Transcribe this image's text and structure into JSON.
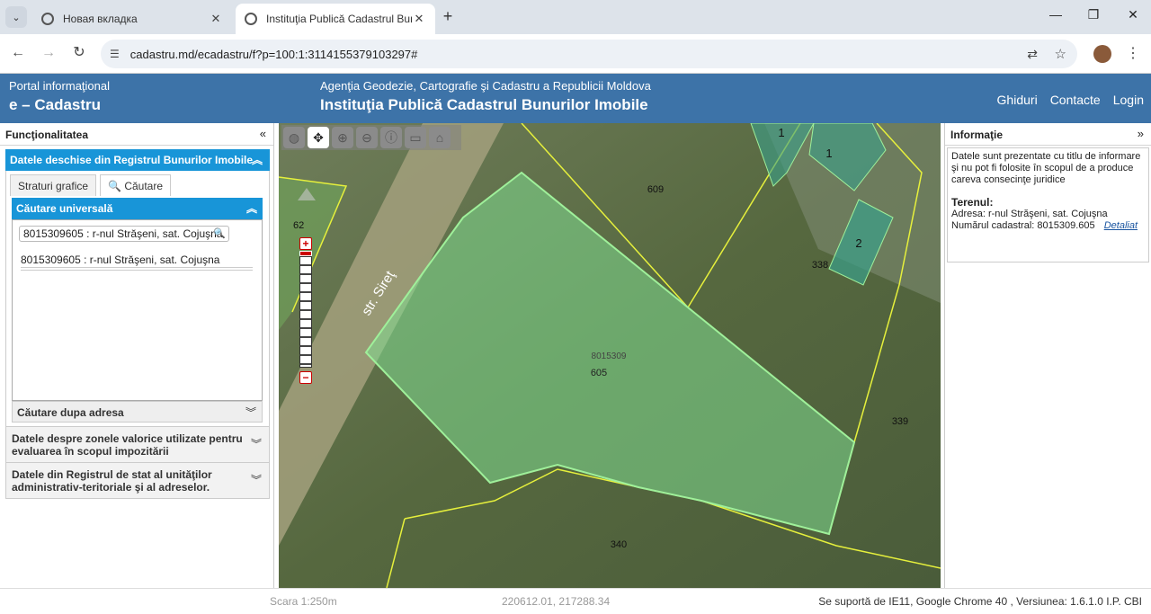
{
  "browser": {
    "tabs": [
      {
        "title": "Новая вкладка"
      },
      {
        "title": "Instituţia Publică Cadastrul Bunurilor Imobile"
      }
    ],
    "url": "cadastru.md/ecadastru/f?p=100:1:3114155379103297#",
    "controls": {
      "minimize": "—",
      "restore": "❐",
      "close": "✕",
      "new_tab": "+",
      "back": "←",
      "forward": "→",
      "reload": "↻",
      "menu": "⋮"
    }
  },
  "header": {
    "portal": "Portal informaţional",
    "brand": "e – Cadastru",
    "agency": "Agenţia Geodezie, Cartografie şi Cadastru a Republicii Moldova",
    "institution": "Instituţia Publică Cadastrul Bunurilor Imobile",
    "links": [
      "Ghiduri",
      "Contacte",
      "Login"
    ]
  },
  "left_panel": {
    "title": "Funcţionalitatea",
    "section_title": "Datele deschise din Registrul Bunurilor Imobile",
    "subtabs": [
      "Straturi grafice",
      "Căutare"
    ],
    "search_title": "Căutare universală",
    "search_value": "8015309605 : r-nul Străşeni, sat. Cojuşna",
    "result": "8015309605 : r-nul Străşeni, sat. Cojuşna",
    "address_search": "Căutare dupa adresa",
    "accordions": [
      "Datele despre zonele valorice utilizate pentru evaluarea în scopul impozitării",
      "Datele din Registrul de stat al unităţilor administrativ-teritoriale şi al adreselor."
    ]
  },
  "map": {
    "street": "str. Sireţ",
    "labels": {
      "parcel_609": "609",
      "parcel_338": "338",
      "parcel_339": "339",
      "parcel_340": "340",
      "building_1a": "1",
      "building_1b": "1",
      "building_2": "2",
      "cadastral_block": "8015309",
      "parcel_605": "605",
      "edge": "62"
    },
    "colors": {
      "parcel_fill": "#7fdc8f",
      "parcel_stroke": "#9ff09a",
      "boundary": "#e6f03c",
      "building": "#3aa08a"
    }
  },
  "right_panel": {
    "title": "Informaţie",
    "disclaimer": "Datele sunt prezentate cu titlu de informare şi nu pot fi folosite în scopul de a produce careva consecinţe juridice",
    "terenul_label": "Terenul:",
    "address": "Adresa: r-nul Străşeni, sat. Cojuşna",
    "cadastral": "Numărul cadastral: 8015309.605",
    "detail_link": "Detaliat"
  },
  "footer": {
    "scale": "Scara 1:250m",
    "coordinates": "220612.01, 217288.34",
    "support": "Se suportă de IE11, Google Chrome 40 , Versiunea: 1.6.1.0 I.P. CBI"
  }
}
